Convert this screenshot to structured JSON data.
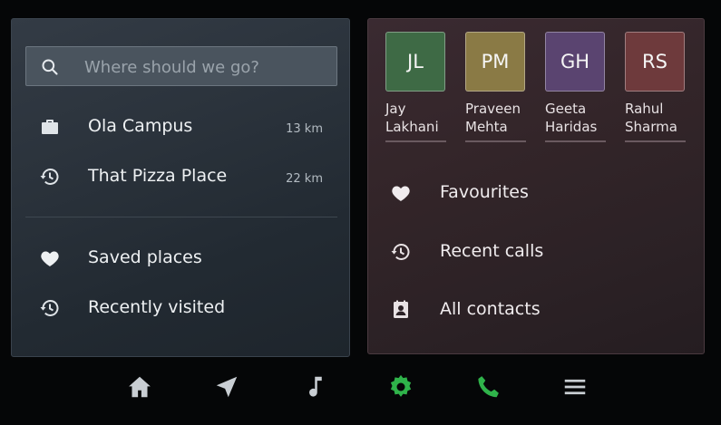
{
  "search": {
    "placeholder": "Where should we go?",
    "icon": "search-icon"
  },
  "destinations": [
    {
      "label": "Ola Campus",
      "distance": "13 km",
      "icon": "briefcase-icon"
    },
    {
      "label": "That Pizza Place",
      "distance": "22 km",
      "icon": "history-icon"
    }
  ],
  "nav_links": [
    {
      "label": "Saved places",
      "icon": "heart-icon"
    },
    {
      "label": "Recently visited",
      "icon": "history-icon"
    }
  ],
  "contacts": [
    {
      "initials": "JL",
      "first": "Jay",
      "last": "Lakhani",
      "color": "#3e6a45"
    },
    {
      "initials": "PM",
      "first": "Praveen",
      "last": "Mehta",
      "color": "#8a7a45"
    },
    {
      "initials": "GH",
      "first": "Geeta",
      "last": "Haridas",
      "color": "#5a4470"
    },
    {
      "initials": "RS",
      "first": "Rahul",
      "last": "Sharma",
      "color": "#6e3a3c"
    }
  ],
  "phone_links": [
    {
      "label": "Favourites",
      "icon": "heart-icon"
    },
    {
      "label": "Recent calls",
      "icon": "history-icon"
    },
    {
      "label": "All contacts",
      "icon": "contacts-icon"
    }
  ],
  "bottom_bar": [
    {
      "name": "home-icon",
      "active": false
    },
    {
      "name": "navigation-icon",
      "active": false
    },
    {
      "name": "music-icon",
      "active": false
    },
    {
      "name": "settings-icon",
      "active": true
    },
    {
      "name": "phone-icon",
      "active": true
    }
  ],
  "colors": {
    "accent_green": "#2fb34a",
    "icon_grey": "#c9ced3"
  }
}
